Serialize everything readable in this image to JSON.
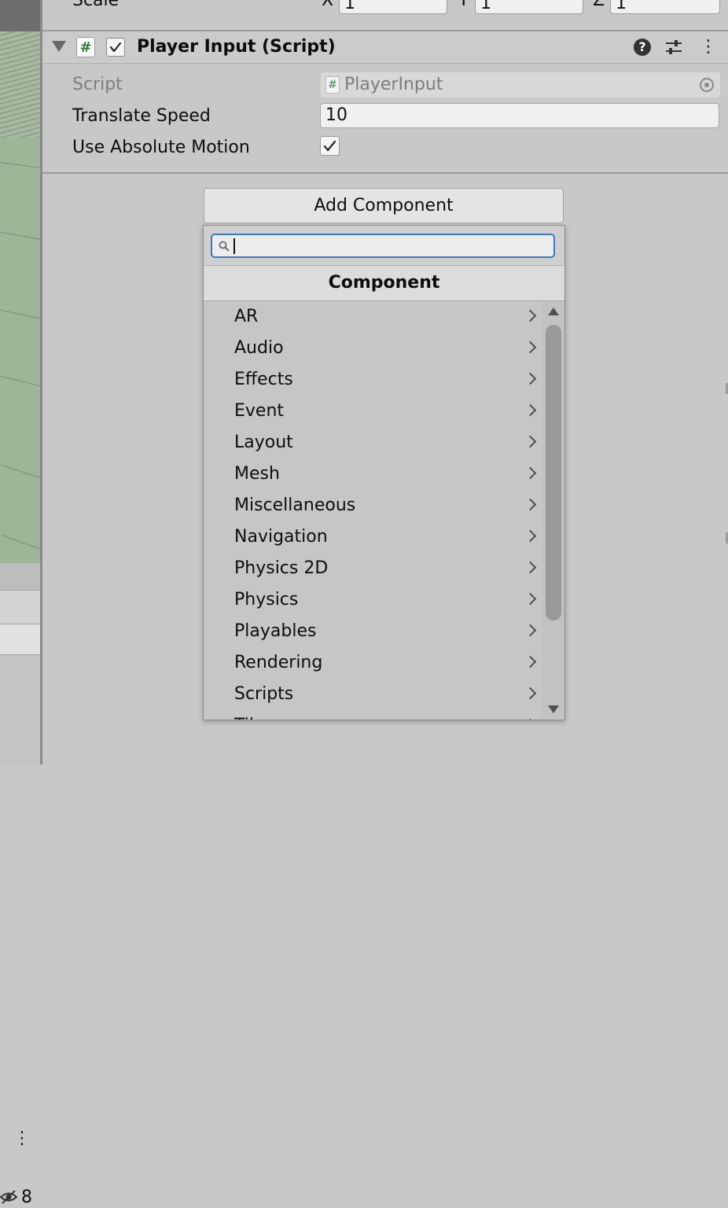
{
  "transform": {
    "scale_label": "Scale",
    "axes": [
      {
        "label": "X",
        "value": "1"
      },
      {
        "label": "Y",
        "value": "1"
      },
      {
        "label": "Z",
        "value": "1"
      }
    ]
  },
  "component": {
    "title": "Player Input (Script)",
    "icon_glyph": "#",
    "help_glyph": "?",
    "properties": {
      "script_label": "Script",
      "script_value": "PlayerInput",
      "translate_speed_label": "Translate Speed",
      "translate_speed_value": "10",
      "use_absolute_motion_label": "Use Absolute Motion"
    }
  },
  "add_component": {
    "button_label": "Add Component",
    "popup_header": "Component",
    "search_value": "",
    "categories": [
      "AR",
      "Audio",
      "Effects",
      "Event",
      "Layout",
      "Mesh",
      "Miscellaneous",
      "Navigation",
      "Physics 2D",
      "Physics",
      "Playables",
      "Rendering",
      "Scripts",
      "Tilemap"
    ]
  },
  "left_panel": {
    "hidden_count": "8"
  },
  "colors": {
    "accent_focus": "#3a79c3",
    "script_icon": "#2e7d32",
    "scene_ground": "#9eb596"
  }
}
